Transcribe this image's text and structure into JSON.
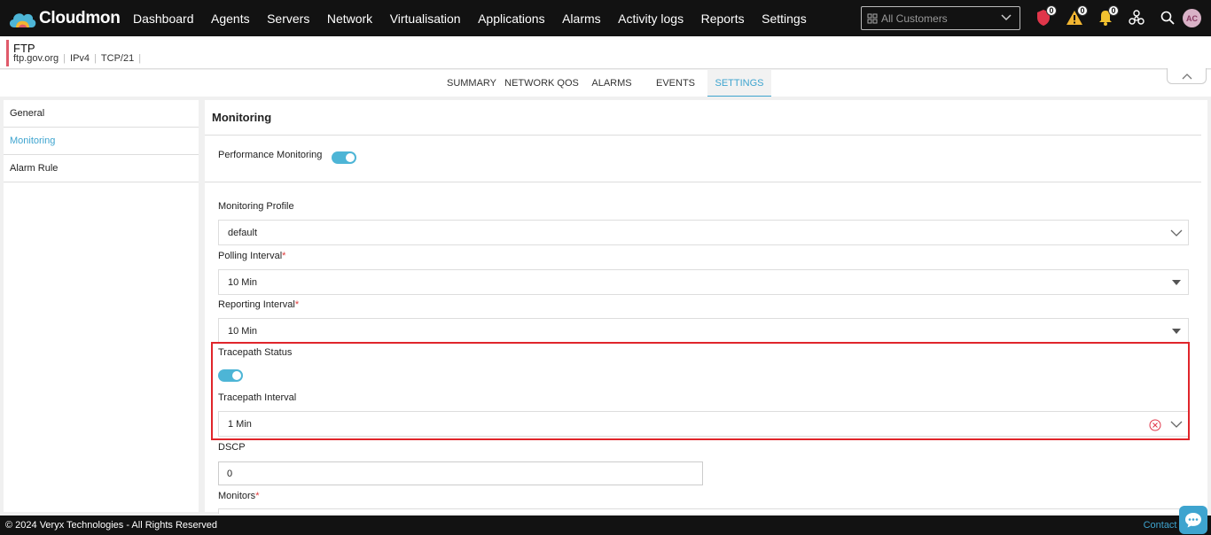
{
  "app": {
    "name": "Cloudmon"
  },
  "nav": {
    "items": [
      "Dashboard",
      "Agents",
      "Servers",
      "Network",
      "Virtualisation",
      "Applications",
      "Alarms",
      "Activity logs",
      "Reports",
      "Settings"
    ]
  },
  "customer_select": {
    "placeholder": "All Customers"
  },
  "notifications": {
    "security": "0",
    "warnings": "0",
    "alerts": "0"
  },
  "user": {
    "initials": "AC"
  },
  "device": {
    "name": "FTP",
    "host": "ftp.gov.org",
    "ip_version": "IPv4",
    "protocol_port": "TCP/21"
  },
  "tabs": [
    "SUMMARY",
    "NETWORK QOS",
    "ALARMS",
    "EVENTS",
    "SETTINGS"
  ],
  "active_tab": "SETTINGS",
  "sidebar": {
    "items": [
      "General",
      "Monitoring",
      "Alarm Rule"
    ],
    "active": "Monitoring"
  },
  "main": {
    "title": "Monitoring",
    "performance_monitoring": {
      "label": "Performance Monitoring",
      "enabled": true
    },
    "monitoring_profile": {
      "label": "Monitoring Profile",
      "value": "default"
    },
    "polling_interval": {
      "label": "Polling Interval",
      "required": "*",
      "value": "10 Min"
    },
    "reporting_interval": {
      "label": "Reporting Interval",
      "required": "*",
      "value": "10 Min"
    },
    "tracepath_status": {
      "label": "Tracepath Status",
      "enabled": true
    },
    "tracepath_interval": {
      "label": "Tracepath Interval",
      "value": "1 Min"
    },
    "dscp": {
      "label": "DSCP",
      "value": "0"
    },
    "monitors": {
      "label": "Monitors",
      "required": "*"
    }
  },
  "footer": {
    "copyright": "© 2024 Veryx Technologies - All Rights Reserved",
    "contact": "Contact Su"
  },
  "colors": {
    "accent": "#3ea4cf",
    "topbar": "#121212",
    "highlight": "#e0252b",
    "required": "#e03a3a"
  }
}
